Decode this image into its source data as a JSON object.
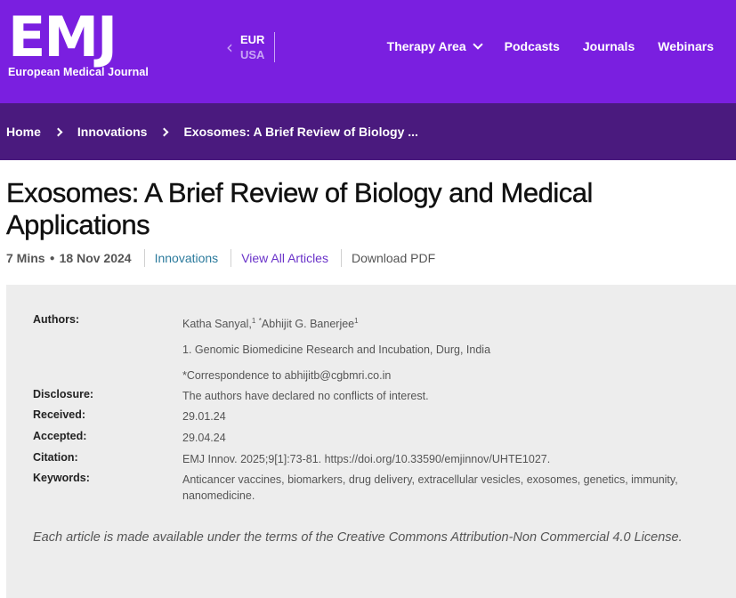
{
  "header": {
    "logo_text": "EMJ",
    "logo_subtitle": "European Medical Journal",
    "region": {
      "current": "EUR",
      "other": "USA"
    },
    "nav": [
      {
        "label": "Therapy Area",
        "has_dropdown": true
      },
      {
        "label": "Podcasts"
      },
      {
        "label": "Journals"
      },
      {
        "label": "Webinars"
      }
    ],
    "colors": {
      "primary": "#7a1fe0",
      "breadcrumb_bg": "#4a1a7e"
    }
  },
  "breadcrumb": [
    "Home",
    "Innovations",
    "Exosomes: A Brief Review of Biology ..."
  ],
  "article": {
    "title": "Exosomes: A Brief Review of Biology and Medical Applications",
    "read_time": "7 Mins",
    "date": "18 Nov 2024",
    "category": "Innovations",
    "view_all": "View All Articles",
    "download": "Download PDF"
  },
  "details": {
    "authors_label": "Authors:",
    "author1": "Katha Sanyal,",
    "author1_sup": "1",
    "author2_sup": "*",
    "author2": "Abhijit G. Banerjee",
    "author2_sup_after": "1",
    "affiliation": "1. Genomic Biomedicine Research and Incubation, Durg, India",
    "correspondence": "*Correspondence to abhijitb@cgbmri.co.in",
    "disclosure_label": "Disclosure:",
    "disclosure": "The authors have declared no conflicts of interest.",
    "received_label": "Received:",
    "received": "29.01.24",
    "accepted_label": "Accepted:",
    "accepted": "29.04.24",
    "citation_label": "Citation:",
    "citation": "EMJ Innov. 2025;9[1]:73-81. https://doi.org/10.33590/emjinnov/UHTE1027.",
    "keywords_label": "Keywords:",
    "keywords": "Anticancer vaccines, biomarkers, drug delivery, extracellular vesicles, exosomes, genetics, immunity, nanomedicine.",
    "license": "Each article is made available under the terms of the Creative Commons Attribution-Non Commercial 4.0 License."
  }
}
